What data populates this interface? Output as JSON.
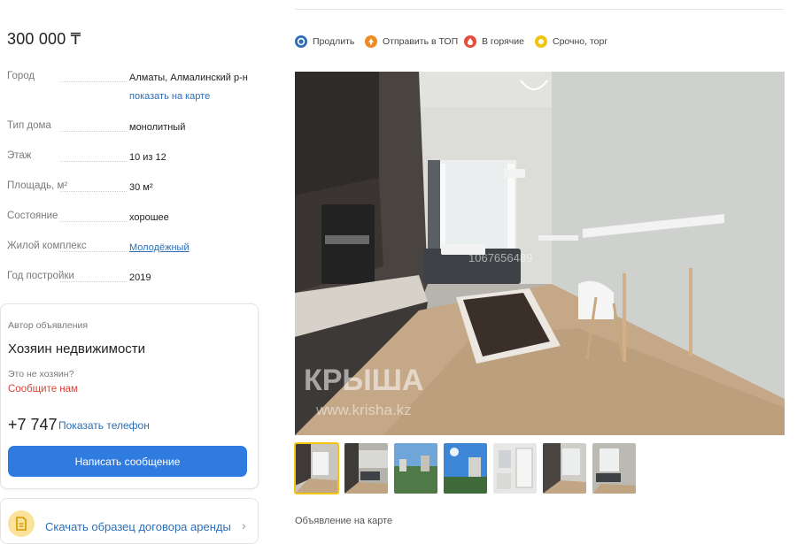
{
  "listing": {
    "price": "300 000 ₸",
    "params": [
      {
        "label": "Город",
        "value": "Алматы, Алмалинский р-н"
      },
      {
        "label": "Тип дома",
        "value": "монолитный"
      },
      {
        "label": "Этаж",
        "value": "10 из 12"
      },
      {
        "label": "Площадь, м²",
        "value": "30 м²"
      },
      {
        "label": "Состояние",
        "value": "хорошее"
      },
      {
        "label": "Жилой комплекс",
        "value": "Молодёжный"
      },
      {
        "label": "Год постройки",
        "value": "2019"
      }
    ],
    "show_on_map": "показать на карте"
  },
  "author": {
    "title": "Автор объявления",
    "name": "Хозяин недвижимости",
    "not_owner_question": "Это не хозяин?",
    "report_link": "Сообщите нам",
    "phone_partial": "+7 747",
    "show_phone": "Показать телефон",
    "message_button": "Написать сообщение"
  },
  "contract": {
    "label": "Скачать образец договора аренды",
    "icon": "document-icon"
  },
  "actions": [
    {
      "label": "Продлить",
      "icon": "renew-icon",
      "color": "#2d6eb6"
    },
    {
      "label": "Отправить в ТОП",
      "icon": "top-arrow-icon",
      "color": "#f08a24"
    },
    {
      "label": "В горячие",
      "icon": "fire-icon",
      "color": "#e74c3c"
    },
    {
      "label": "Срочно, торг",
      "icon": "urgent-icon",
      "color": "#f1c40f"
    }
  ],
  "gallery": {
    "watermark_text": "КРЫША",
    "watermark_url": "www.krisha.kz",
    "listing_number": "1067656489",
    "thumbnail_count": 7,
    "active_thumbnail": 1
  },
  "map_caption": "Объявление на карте",
  "colors": {
    "accent": "#2f7bdf",
    "link": "#2d6eb6",
    "danger": "#d8433a",
    "active_thumb_border": "#f1c40f"
  }
}
